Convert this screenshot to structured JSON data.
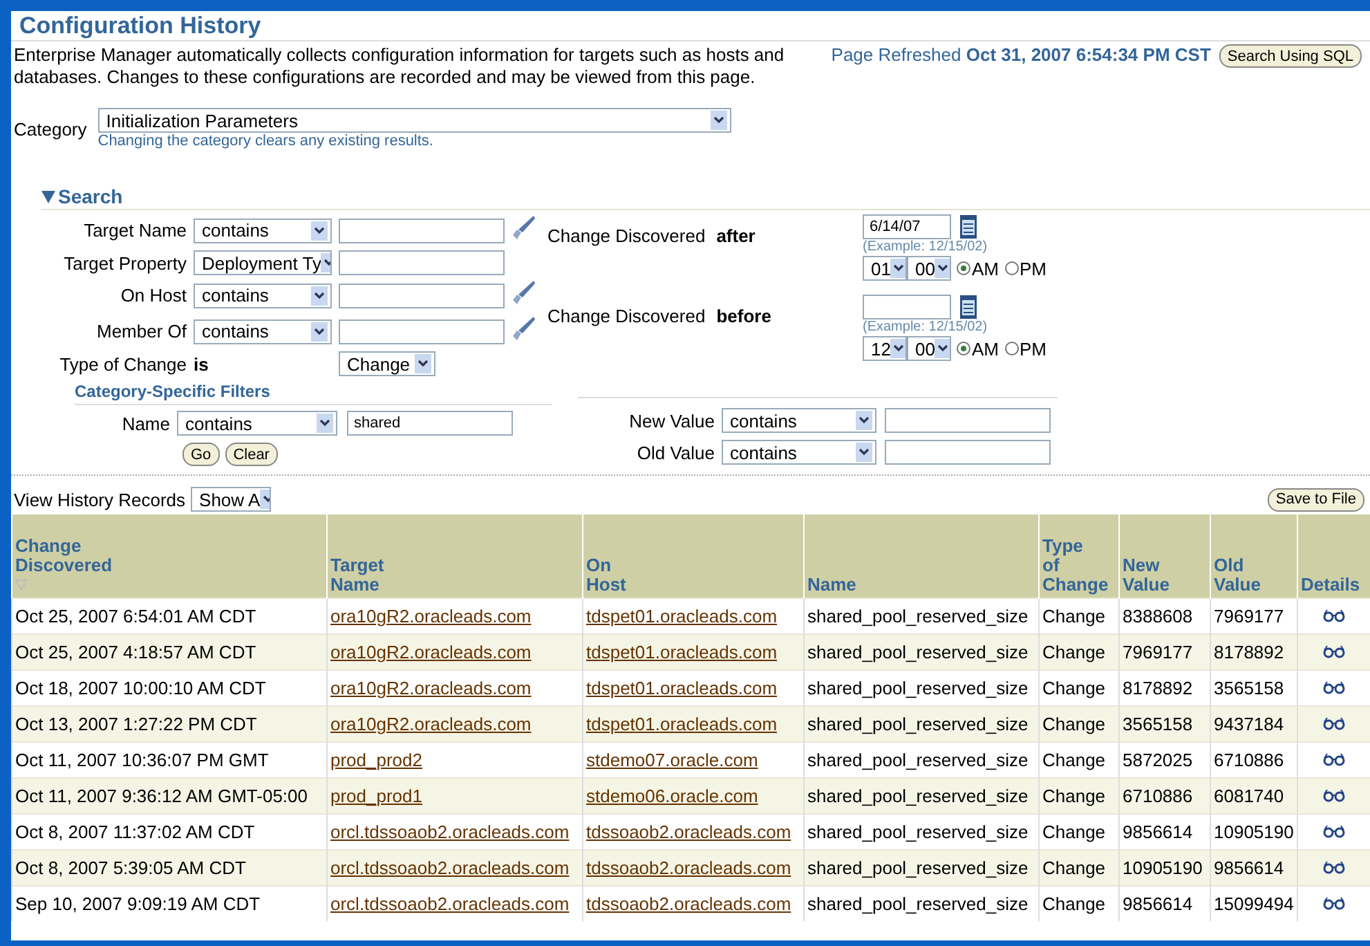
{
  "title": "Configuration History",
  "description": "Enterprise Manager automatically collects configuration information for targets such as hosts and databases. Changes to these configurations are recorded and may be viewed from this page.",
  "refreshed": {
    "label": "Page Refreshed",
    "value": "Oct 31, 2007 6:54:34 PM CST"
  },
  "search_sql_button": "Search Using SQL",
  "category": {
    "label": "Category",
    "value": "Initialization Parameters",
    "hint": "Changing the category clears any existing results."
  },
  "search": {
    "title": "Search",
    "expanded": true,
    "criteria": [
      {
        "kind": "text",
        "label": "Target Name",
        "operator": "contains",
        "picker": true
      },
      {
        "kind": "text",
        "label": "Target Property",
        "operator": "Deployment Ty",
        "picker": false
      },
      {
        "kind": "text",
        "label": "On Host",
        "operator": "contains",
        "picker": true
      },
      {
        "kind": "text",
        "label": "Member Of",
        "operator": "contains",
        "picker": true
      },
      {
        "kind": "choice",
        "label": "Type of Change",
        "operator": "is",
        "value": "Change",
        "picker": false
      }
    ],
    "dates": [
      {
        "label": "Change Discovered",
        "qualifier": "after",
        "date": "6/14/07",
        "example": "(Example: 12/15/02)",
        "hour": "01",
        "minute": "00",
        "periods": [
          {
            "label": "AM",
            "selected": true
          },
          {
            "label": "PM",
            "selected": false
          }
        ]
      },
      {
        "label": "Change Discovered",
        "qualifier": "before",
        "example": "(Example: 12/15/02)",
        "hour": "12",
        "minute": "00",
        "periods": [
          {
            "label": "AM",
            "selected": true
          },
          {
            "label": "PM",
            "selected": false
          }
        ]
      }
    ],
    "category_filters": {
      "title": "Category-Specific Filters",
      "left": [
        {
          "label": "Name",
          "operator": "contains",
          "value": "shared"
        }
      ],
      "right": [
        {
          "label": "New Value",
          "operator": "contains"
        },
        {
          "label": "Old Value",
          "operator": "contains"
        }
      ],
      "buttons": [
        "Go",
        "Clear"
      ]
    }
  },
  "view_history": {
    "label": "View History Records",
    "value": "Show A"
  },
  "save_button": "Save to File",
  "table": {
    "columns": [
      {
        "lines": [
          "Change",
          "Discovered"
        ],
        "sorted": true
      },
      {
        "lines": [
          "Target",
          "Name"
        ],
        "sorted": false
      },
      {
        "lines": [
          "On",
          "Host"
        ],
        "sorted": false
      },
      {
        "lines": [
          "Name"
        ],
        "sorted": false
      },
      {
        "lines": [
          "Type",
          "of",
          "Change"
        ],
        "sorted": false
      },
      {
        "lines": [
          "New",
          "Value"
        ],
        "sorted": false
      },
      {
        "lines": [
          "Old",
          "Value"
        ],
        "sorted": false
      },
      {
        "lines": [
          "Details"
        ],
        "sorted": false
      }
    ],
    "rows": [
      {
        "discovered": "Oct 25, 2007 6:54:01 AM CDT",
        "target": "ora10gR2.oracleads.com",
        "host": "tdspet01.oracleads.com",
        "name": "shared_pool_reserved_size",
        "type": "Change",
        "new": "8388608",
        "old": "7969177"
      },
      {
        "discovered": "Oct 25, 2007 4:18:57 AM CDT",
        "target": "ora10gR2.oracleads.com",
        "host": "tdspet01.oracleads.com",
        "name": "shared_pool_reserved_size",
        "type": "Change",
        "new": "7969177",
        "old": "8178892"
      },
      {
        "discovered": "Oct 18, 2007 10:00:10 AM CDT",
        "target": "ora10gR2.oracleads.com",
        "host": "tdspet01.oracleads.com",
        "name": "shared_pool_reserved_size",
        "type": "Change",
        "new": "8178892",
        "old": "3565158"
      },
      {
        "discovered": "Oct 13, 2007 1:27:22 PM CDT",
        "target": "ora10gR2.oracleads.com",
        "host": "tdspet01.oracleads.com",
        "name": "shared_pool_reserved_size",
        "type": "Change",
        "new": "3565158",
        "old": "9437184"
      },
      {
        "discovered": "Oct 11, 2007 10:36:07 PM GMT",
        "target": "prod_prod2",
        "host": "stdemo07.oracle.com",
        "name": "shared_pool_reserved_size",
        "type": "Change",
        "new": "5872025",
        "old": "6710886"
      },
      {
        "discovered": "Oct 11, 2007 9:36:12 AM GMT-05:00",
        "target": "prod_prod1",
        "host": "stdemo06.oracle.com",
        "name": "shared_pool_reserved_size",
        "type": "Change",
        "new": "6710886",
        "old": "6081740"
      },
      {
        "discovered": "Oct 8, 2007 11:37:02 AM CDT",
        "target": "orcl.tdssoaob2.oracleads.com",
        "host": "tdssoaob2.oracleads.com",
        "name": "shared_pool_reserved_size",
        "type": "Change",
        "new": "9856614",
        "old": "10905190"
      },
      {
        "discovered": "Oct 8, 2007 5:39:05 AM CDT",
        "target": "orcl.tdssoaob2.oracleads.com",
        "host": "tdssoaob2.oracleads.com",
        "name": "shared_pool_reserved_size",
        "type": "Change",
        "new": "10905190",
        "old": "9856614"
      },
      {
        "discovered": "Sep 10, 2007 9:09:19 AM CDT",
        "target": "orcl.tdssoaob2.oracleads.com",
        "host": "tdssoaob2.oracleads.com",
        "name": "shared_pool_reserved_size",
        "type": "Change",
        "new": "9856614",
        "old": "15099494"
      }
    ]
  }
}
